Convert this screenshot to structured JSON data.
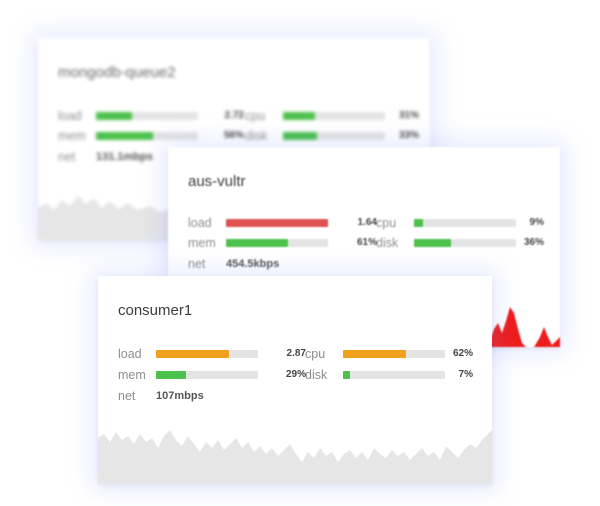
{
  "colors": {
    "red": "#e05252",
    "green": "#4cc14c",
    "orange": "#f0a21f",
    "track": "#e4e4e4",
    "chart_grey": "#e6e6e6",
    "chart_red": "#ee1c1c"
  },
  "cards": [
    {
      "title": "mongodb-queue2",
      "load": {
        "label": "load",
        "value": "2.72",
        "level": 0.35,
        "color": "green"
      },
      "cpu": {
        "label": "cpu",
        "value": "31%",
        "level": 0.31,
        "color": "green"
      },
      "mem": {
        "label": "mem",
        "value": "56%",
        "level": 0.56,
        "color": "green"
      },
      "disk": {
        "label": "disk",
        "value": "33%",
        "level": 0.33,
        "color": "green"
      },
      "net": {
        "label": "net",
        "value": "131.1mbps"
      }
    },
    {
      "title": "aus-vultr",
      "load": {
        "label": "load",
        "value": "1.64",
        "level": 1.0,
        "color": "red"
      },
      "cpu": {
        "label": "cpu",
        "value": "9%",
        "level": 0.09,
        "color": "green"
      },
      "mem": {
        "label": "mem",
        "value": "61%",
        "level": 0.61,
        "color": "green"
      },
      "disk": {
        "label": "disk",
        "value": "36%",
        "level": 0.36,
        "color": "green"
      },
      "net": {
        "label": "net",
        "value": "454.5kbps"
      }
    },
    {
      "title": "consumer1",
      "load": {
        "label": "load",
        "value": "2.87",
        "level": 0.72,
        "color": "orange"
      },
      "cpu": {
        "label": "cpu",
        "value": "62%",
        "level": 0.62,
        "color": "orange"
      },
      "mem": {
        "label": "mem",
        "value": "29%",
        "level": 0.29,
        "color": "green"
      },
      "disk": {
        "label": "disk",
        "value": "7%",
        "level": 0.07,
        "color": "green"
      },
      "net": {
        "label": "net",
        "value": "107mbps"
      }
    }
  ]
}
